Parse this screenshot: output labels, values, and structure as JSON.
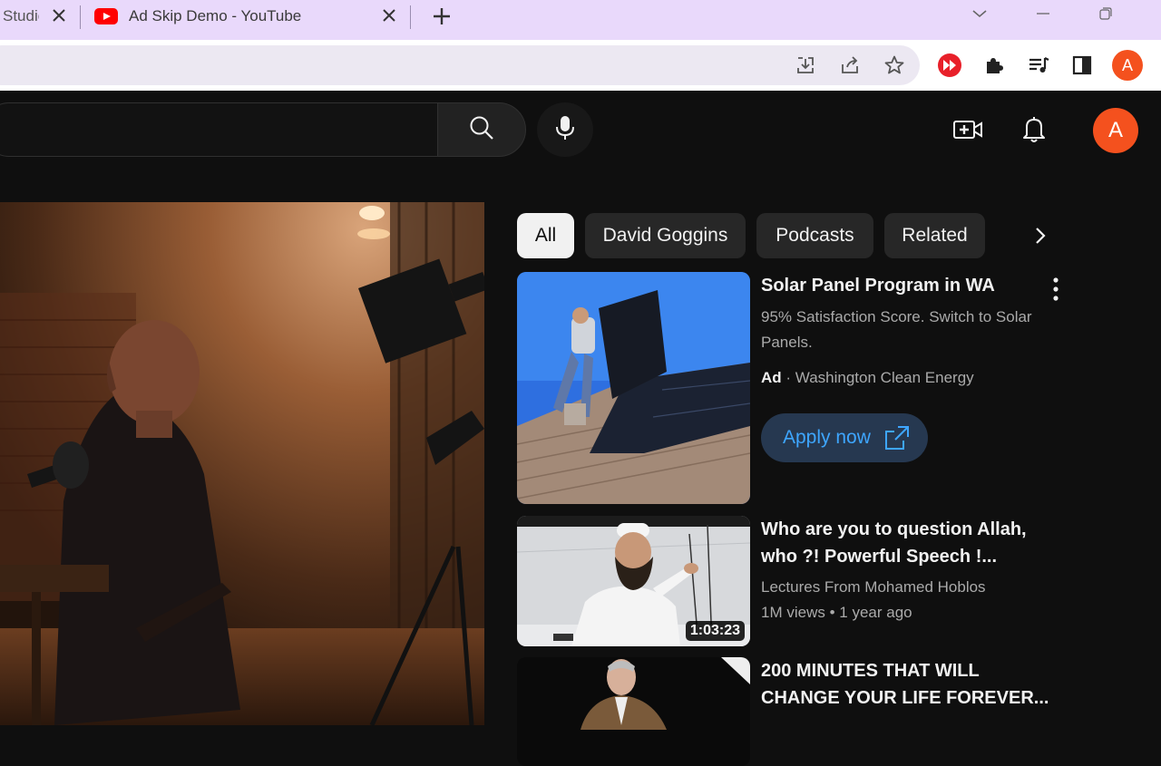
{
  "browser": {
    "tabs": [
      {
        "label": "Studio"
      },
      {
        "label": "Ad Skip Demo - YouTube"
      }
    ]
  },
  "youtube": {
    "avatar_letter": "A",
    "chips": [
      "All",
      "David Goggins",
      "Podcasts",
      "Related"
    ],
    "recommendations": [
      {
        "title": "Solar Panel Program in WA",
        "description": "95% Satisfaction Score. Switch to Solar Panels.",
        "ad_badge": "Ad",
        "advertiser": "Washington Clean Energy",
        "cta": "Apply now"
      },
      {
        "title": "Who are you to question Allah, who ?! Powerful Speech !...",
        "channel": "Lectures From Mohamed Hoblos",
        "views": "1M views",
        "age": "1 year ago",
        "duration": "1:03:23"
      },
      {
        "title": "200 MINUTES THAT WILL CHANGE YOUR LIFE FOREVER..."
      }
    ]
  },
  "colors": {
    "tabbar": "#e9d9fb",
    "yt_background": "#0f0f0f",
    "avatar": "#f4511e",
    "link_blue": "#3ea6ff"
  }
}
